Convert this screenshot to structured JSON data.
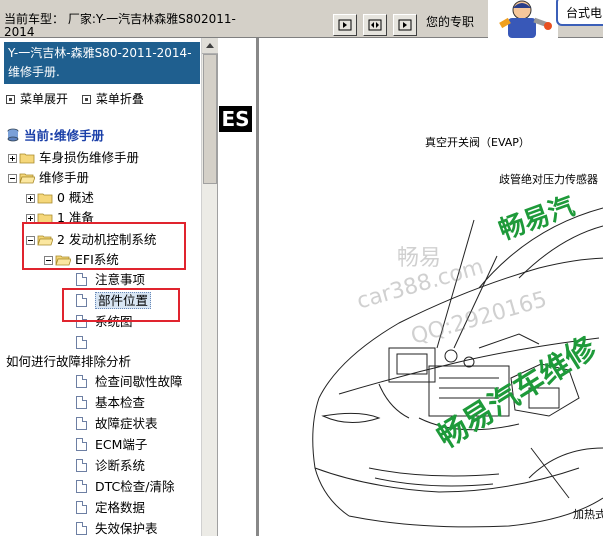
{
  "header": {
    "model_label": "当前车型： 厂家:Y-一汽吉林森雅S802011-2014",
    "pro_text": "您的专职",
    "desktop_label": "台式电",
    "nav_buttons": [
      {
        "icon": "prev-icon"
      },
      {
        "icon": "resize-icon"
      },
      {
        "icon": "next-icon"
      }
    ]
  },
  "sidebar": {
    "doc_title": "Y-一汽吉林-森雅S80-2011-2014- 维修手册.",
    "expand_label": "菜单展开",
    "collapse_label": "菜单折叠",
    "current_label": "当前:维修手册",
    "tree": [
      {
        "label": "车身损伤维修手册",
        "kind": "folder",
        "toggle": "plus"
      },
      {
        "label": "维修手册",
        "kind": "folder",
        "toggle": "minus"
      },
      {
        "label": "0 概述",
        "kind": "folder",
        "toggle": "plus"
      },
      {
        "label": "1 准备",
        "kind": "folder",
        "toggle": "plus"
      },
      {
        "label": "2 发动机控制系统",
        "kind": "folder",
        "toggle": "minus"
      },
      {
        "label": "EFI系统",
        "kind": "folder",
        "toggle": "minus"
      },
      {
        "label": "注意事项",
        "kind": "page"
      },
      {
        "label": "部件位置",
        "kind": "page",
        "selected": true
      },
      {
        "label": "系统图",
        "kind": "page"
      },
      {
        "label": "",
        "kind": "page"
      },
      {
        "label": "如何进行故障排除分析",
        "kind": "text"
      },
      {
        "label": "检查间歇性故障",
        "kind": "page"
      },
      {
        "label": "基本检查",
        "kind": "page"
      },
      {
        "label": "故障症状表",
        "kind": "page"
      },
      {
        "label": "ECM端子",
        "kind": "page"
      },
      {
        "label": "诊断系统",
        "kind": "page"
      },
      {
        "label": "DTC检查/清除",
        "kind": "page"
      },
      {
        "label": "定格数据",
        "kind": "page"
      },
      {
        "label": "失效保护表",
        "kind": "page"
      }
    ]
  },
  "content": {
    "section_tag": "ES",
    "callouts": {
      "vacuum_valve": "真空开关阀（EVAP）",
      "map_sensor": "歧管绝对压力传感器",
      "heater": "加热式"
    },
    "watermarks": {
      "brand_cn": "畅易",
      "site": "car388.com",
      "qq": "QQ:2920165",
      "green_top": "畅易汽",
      "green_main": "畅易汽车维修"
    }
  },
  "colors": {
    "title_bg": "#1f5f8f",
    "highlight_border": "#e0242e",
    "watermark_green": "#1e9a3a",
    "selected_bg": "#d9e6f4"
  }
}
